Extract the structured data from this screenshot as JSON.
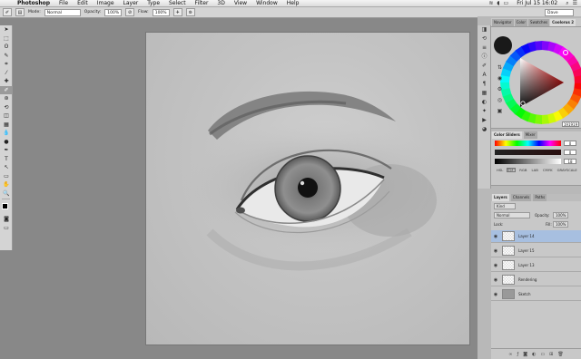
{
  "menubar": {
    "app_name": "Photoshop",
    "items": [
      "File",
      "Edit",
      "Image",
      "Layer",
      "Type",
      "Select",
      "Filter",
      "3D",
      "View",
      "Window",
      "Help"
    ],
    "clock": "Fri Jul 15  16:02",
    "user": "Dave"
  },
  "options_bar": {
    "mode_label": "Mode:",
    "mode_value": "Normal",
    "opacity_label": "Opacity:",
    "opacity_value": "100%",
    "flow_label": "Flow:",
    "flow_value": "100%",
    "workspace": "Dave"
  },
  "tools": [
    "move-tool",
    "marquee-tool",
    "lasso-tool",
    "quick-select-tool",
    "crop-tool",
    "eyedropper-tool",
    "healing-tool",
    "brush-tool",
    "clone-stamp-tool",
    "history-brush-tool",
    "eraser-tool",
    "gradient-tool",
    "blur-tool",
    "dodge-tool",
    "pen-tool",
    "type-tool",
    "path-select-tool",
    "shape-tool",
    "hand-tool",
    "zoom-tool"
  ],
  "tool_glyphs": [
    "➤",
    "⬚",
    "ʘ",
    "✎",
    "⌗",
    "⁄",
    "✚",
    "✐",
    "⊛",
    "⟲",
    "◫",
    "▦",
    "💧",
    "●",
    "✒",
    "T",
    "↖",
    "▭",
    "✋",
    "🔍"
  ],
  "active_tool_index": 7,
  "panels": {
    "top_tabs": [
      "Navigator",
      "Color",
      "Swatches",
      "Coolorus 2"
    ],
    "hex_value": "191919",
    "color_sliders_tabs": [
      "Color Sliders",
      "Mixer"
    ],
    "slider_values": [
      "0",
      "0",
      "18"
    ],
    "color_modes": [
      "HSL",
      "HSB",
      "RGB",
      "LAB",
      "CMYK",
      "GRAYSCALE"
    ],
    "active_mode": "HSB",
    "layers_tabs": [
      "Layers",
      "Channels",
      "Paths"
    ],
    "layers_kind": "Kind",
    "layers_blend": "Normal",
    "layers_opacity_label": "Opacity:",
    "layers_opacity": "100%",
    "layers_lock_label": "Lock:",
    "layers_fill_label": "Fill:",
    "layers_fill": "100%",
    "layers": [
      {
        "name": "Layer 14",
        "selected": true,
        "solid": false
      },
      {
        "name": "Layer 15",
        "selected": false,
        "solid": false
      },
      {
        "name": "Layer 13",
        "selected": false,
        "solid": false
      },
      {
        "name": "Rendering",
        "selected": false,
        "solid": false
      },
      {
        "name": "Sketch",
        "selected": false,
        "solid": true
      }
    ]
  },
  "colors": {
    "accent_selected_layer": "#a7bfe0",
    "foreground": "#191919"
  }
}
